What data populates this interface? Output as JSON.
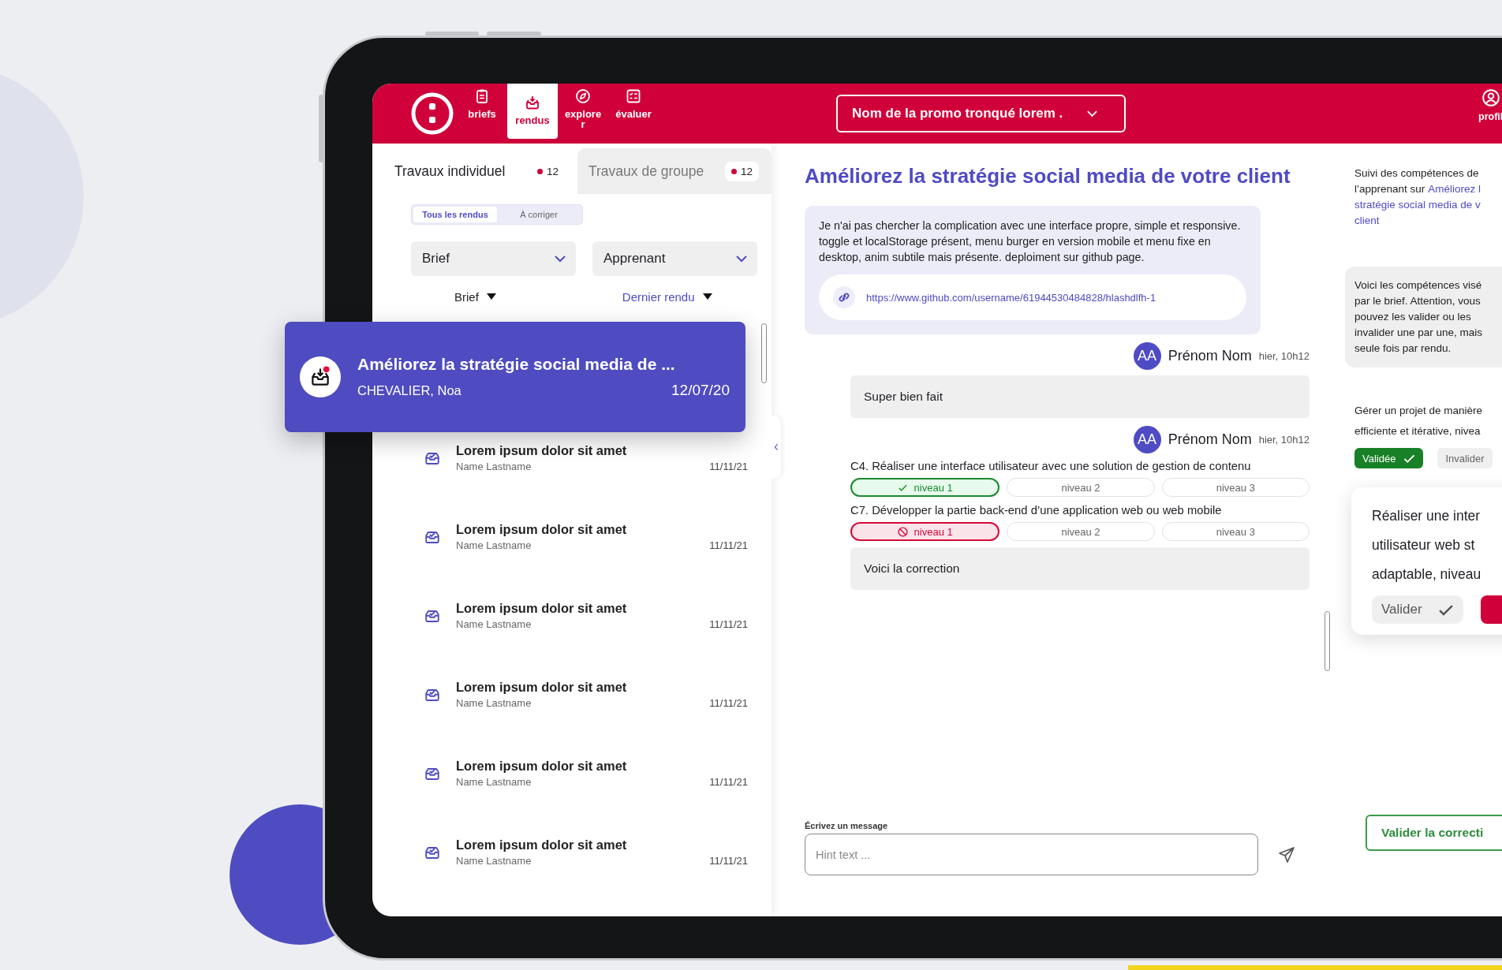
{
  "nav": {
    "items": [
      {
        "label": "briefs",
        "selected": false
      },
      {
        "label": "rendus",
        "selected": true
      },
      {
        "label": "explorer",
        "selected": false
      },
      {
        "label": "évaluer",
        "selected": false
      }
    ],
    "promo_select": "Nom de la promo tronqué lorem .",
    "profile": "profil"
  },
  "left_panel": {
    "tabs": [
      {
        "label": "Travaux individuel",
        "count": "12",
        "selected": true
      },
      {
        "label": "Travaux de groupe",
        "count": "12",
        "selected": false
      }
    ],
    "filter": [
      {
        "label": "Tous les rendus",
        "selected": true
      },
      {
        "label": "À corriger",
        "selected": false
      }
    ],
    "dropdowns": [
      "Brief",
      "Apprenant"
    ],
    "sort": [
      {
        "label": "Brief",
        "active": false
      },
      {
        "label": "Dernier rendu",
        "active": true
      }
    ],
    "highlight": {
      "title": "Améliorez la stratégie social media de ...",
      "learner": "CHEVALIER, Noa",
      "date": "12/07/20",
      "unread": true
    },
    "rows": [
      {
        "title": "Lorem ipsum dolor sit amet",
        "name": "Name Lastname",
        "date": "11/11/21"
      },
      {
        "title": "Lorem ipsum dolor sit amet",
        "name": "Name Lastname",
        "date": "11/11/21"
      },
      {
        "title": "Lorem ipsum dolor sit amet",
        "name": "Name Lastname",
        "date": "11/11/21"
      },
      {
        "title": "Lorem ipsum dolor sit amet",
        "name": "Name Lastname",
        "date": "11/11/21"
      },
      {
        "title": "Lorem ipsum dolor sit amet",
        "name": "Name Lastname",
        "date": "11/11/21"
      },
      {
        "title": "Lorem ipsum dolor sit amet",
        "name": "Name Lastname",
        "date": "11/11/21"
      }
    ]
  },
  "main": {
    "title": "Améliorez la stratégie social media de votre client",
    "submission": {
      "text": "Je n'ai pas chercher la complication avec une interface propre, simple et responsive. toggle et localStorage présent, menu burger en version mobile et menu fixe en desktop, anim subtile mais présente. deploiment sur github page.",
      "link": "https://www.github.com/username/61944530484828/hlashdlfh-1"
    },
    "messages": [
      {
        "kind": "comment",
        "avatar": "AA",
        "author": "Prénom Nom",
        "time": "hier, 10h12",
        "text": "Super bien fait"
      },
      {
        "kind": "evaluation",
        "avatar": "AA",
        "author": "Prénom Nom",
        "time": "hier, 10h12",
        "skills": [
          {
            "label": "C4. Réaliser une interface utilisateur avec une solution de gestion de contenu",
            "levels": [
              {
                "label": "niveau 1",
                "validated": true,
                "invalidated": false
              },
              {
                "label": "niveau 2",
                "validated": false,
                "invalidated": false
              },
              {
                "label": "niveau 3",
                "validated": false,
                "invalidated": false
              }
            ]
          },
          {
            "label": "C7. Développer la partie back-end d’une application web ou web mobile",
            "levels": [
              {
                "label": "niveau 1",
                "validated": false,
                "invalidated": true
              },
              {
                "label": "niveau 2",
                "validated": false,
                "invalidated": false
              },
              {
                "label": "niveau 3",
                "validated": false,
                "invalidated": false
              }
            ]
          }
        ],
        "text": "Voici la correction"
      }
    ],
    "composer": {
      "label": "Écrivez un message",
      "placeholder": "Hint text ..."
    }
  },
  "right_panel": {
    "intro_lines": [
      {
        "text": "Suivi des compétences de"
      },
      {
        "text": "l’apprenant sur",
        "link": "Améliorez l"
      },
      {
        "link": "stratégie social media de v"
      },
      {
        "link": "client"
      }
    ],
    "notice_lines": [
      "Voici les compétences visé",
      "par le brief. Attention, vous",
      "pouvez les valider ou les",
      "invalider une par une, mais",
      "seule fois par rendu."
    ],
    "skill": {
      "lines": [
        "Gérer un projet de manière",
        "efficiente et itérative, nivea"
      ],
      "validated": true,
      "validate_label": "Validée",
      "invalidate_label": "Invalider"
    },
    "card": {
      "lines": [
        "Réaliser une inter",
        "utilisateur web st",
        "adaptable, niveau"
      ],
      "validate_label": "Valider"
    },
    "submit": "Valider la correcti"
  }
}
